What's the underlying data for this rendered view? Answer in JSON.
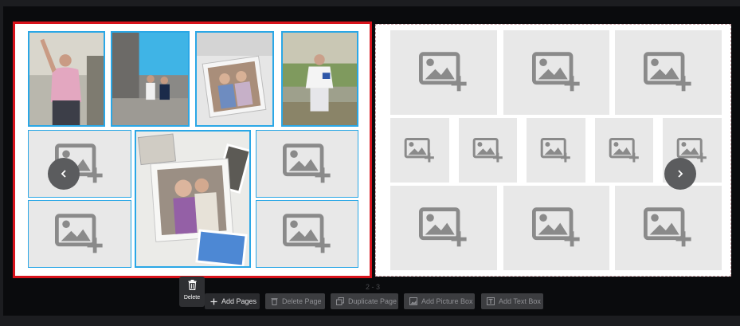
{
  "spread": {
    "page_indicator": "2 - 3",
    "left_page": {
      "selected": true
    },
    "right_page": {
      "selected": false
    }
  },
  "navigation": {
    "prev_icon": "chevron-left-icon",
    "next_icon": "chevron-right-icon"
  },
  "context_menu": {
    "delete_label": "Delete",
    "icon": "trash-icon"
  },
  "toolbar": {
    "add_pages_label": "Add Pages",
    "delete_page_label": "Delete Page",
    "duplicate_page_label": "Duplicate Page",
    "add_picture_box_label": "Add Picture Box",
    "add_text_box_label": "Add Text Box"
  },
  "colors": {
    "selection_border": "#d8121b",
    "frame_border": "#2aa7e6",
    "placeholder_bg": "#e8e8e8",
    "placeholder_icon": "#8a8a8a"
  }
}
